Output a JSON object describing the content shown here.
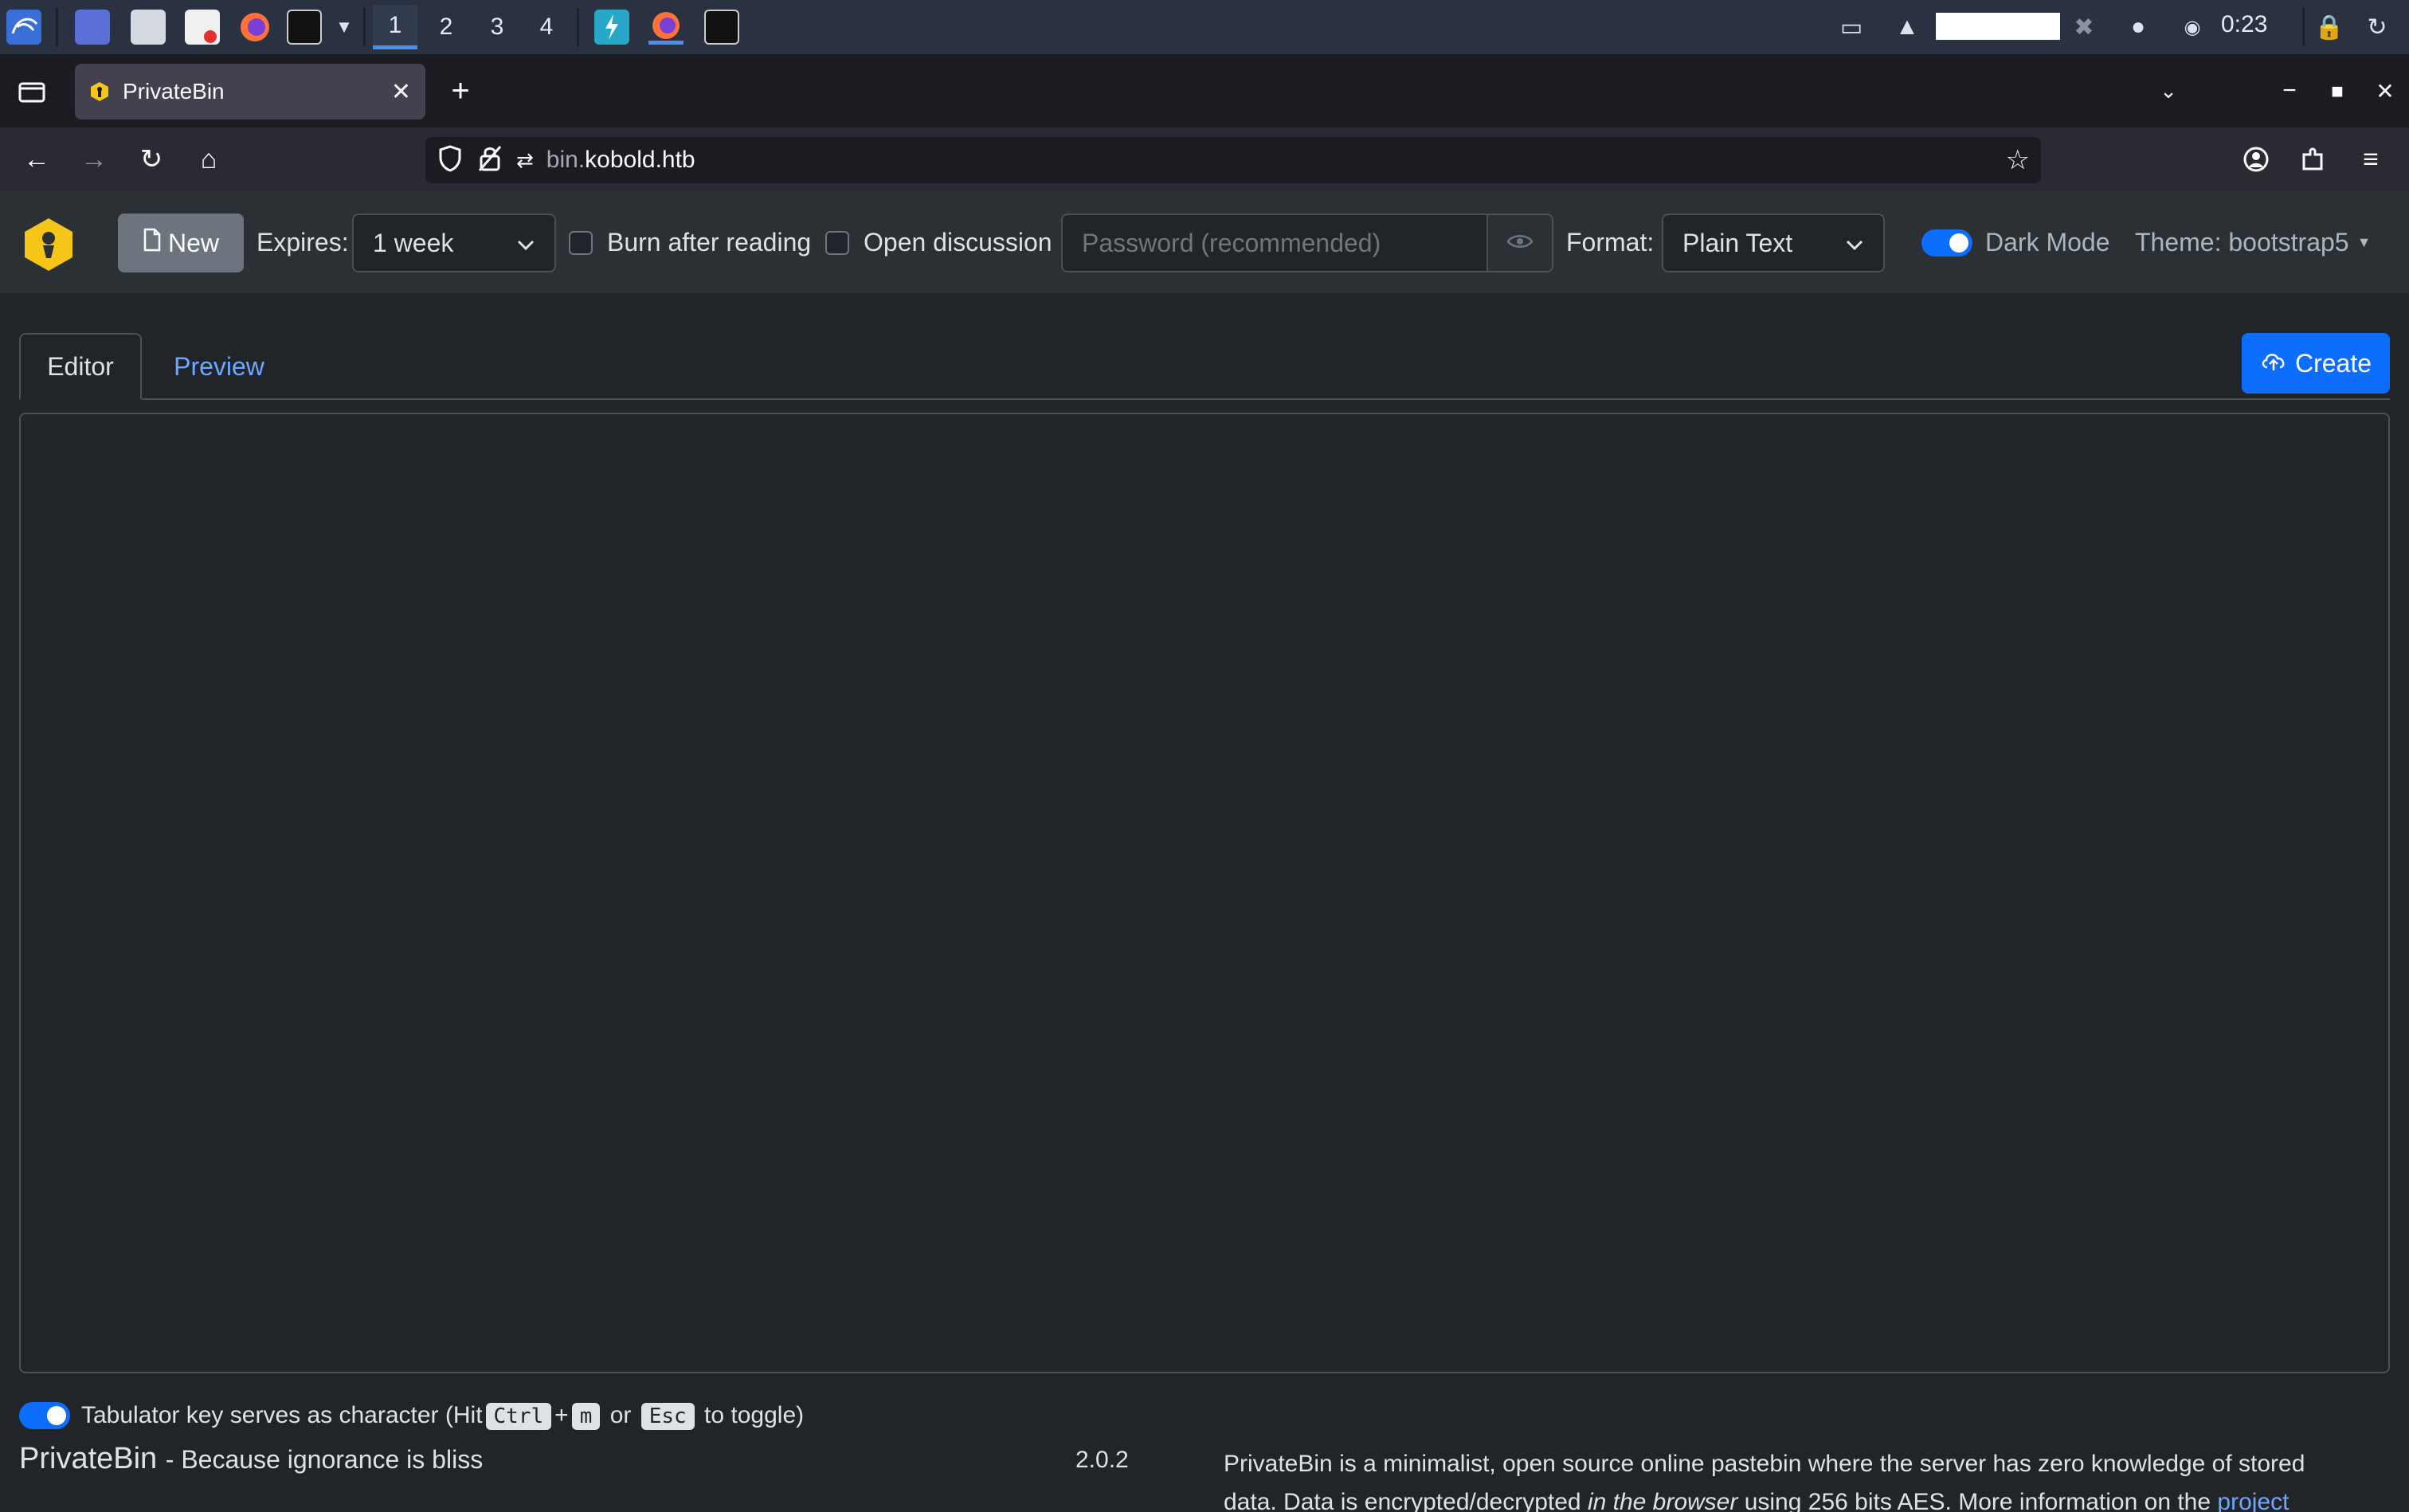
{
  "taskbar": {
    "workspaces": [
      "1",
      "2",
      "3",
      "4"
    ],
    "active_workspace": "1",
    "clock": "0:23"
  },
  "browser": {
    "tab_title": "PrivateBin",
    "url_domain_prefix": "bin.",
    "url_domain": "kobold.htb"
  },
  "header": {
    "new_label": "New",
    "expires_label": "Expires:",
    "expires_value": "1 week",
    "burn_label": "Burn after reading",
    "discussion_label": "Open discussion",
    "password_placeholder": "Password (recommended)",
    "format_label": "Format:",
    "format_value": "Plain Text",
    "dark_mode_label": "Dark Mode",
    "theme_label": "Theme: bootstrap5"
  },
  "editor": {
    "tab_editor": "Editor",
    "tab_preview": "Preview",
    "create_label": "Create",
    "content": ""
  },
  "footer": {
    "tab_toggle_pre": "Tabulator key serves as character (Hit",
    "key_ctrl": "Ctrl",
    "plus": "+",
    "key_m": "m",
    "or": "or",
    "key_esc": "Esc",
    "tab_toggle_post": "to toggle)",
    "app_name": "PrivateBin",
    "tagline": "- Because ignorance is bliss",
    "version": "2.0.2",
    "about_1": "PrivateBin is a minimalist, open source online pastebin where the server has zero knowledge of stored",
    "about_2a": "data. Data is encrypted/decrypted ",
    "about_2b": "in the browser",
    "about_2c": " using 256 bits AES. More information on the ",
    "about_link": "project"
  },
  "colors": {
    "primary": "#0d6efd",
    "page_bg": "#212529",
    "header_bg": "#2b3035",
    "logo_yellow": "#f5c518"
  }
}
